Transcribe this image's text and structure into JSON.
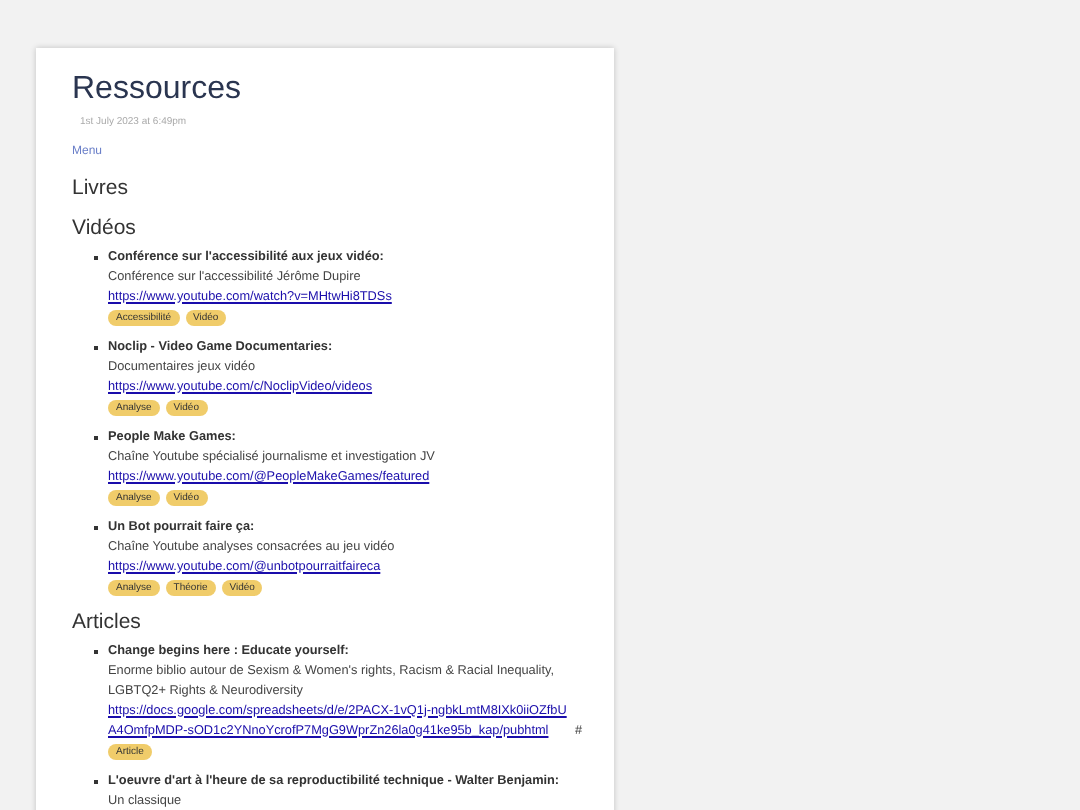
{
  "page": {
    "title": "Ressources",
    "date": "1st July 2023 at 6:49pm",
    "menu_link": "Menu"
  },
  "sections": [
    {
      "title": "Livres"
    },
    {
      "title": "Vidéos",
      "items": [
        {
          "title": "Conférence sur l'accessibilité aux jeux vidéo:",
          "description": "Conférence sur l'accessibilité Jérôme Dupire",
          "link": "https://www.youtube.com/watch?v=MHtwHi8TDSs",
          "tags": [
            "Accessibilité",
            "Vidéo"
          ]
        },
        {
          "title": "Noclip - Video Game Documentaries:",
          "description": "Documentaires jeux vidéo",
          "link": "https://www.youtube.com/c/NoclipVideo/videos",
          "tags": [
            "Analyse",
            "Vidéo"
          ]
        },
        {
          "title": "People Make Games:",
          "description": "Chaîne Youtube spécialisé journalisme et investigation JV",
          "link": "https://www.youtube.com/@PeopleMakeGames/featured",
          "tags": [
            "Analyse",
            "Vidéo"
          ]
        },
        {
          "title": "Un Bot pourrait faire ça:",
          "description": "Chaîne Youtube analyses consacrées au jeu vidéo",
          "link": "https://www.youtube.com/@unbotpourraitfaireca",
          "tags": [
            "Analyse",
            "Théorie",
            "Vidéo"
          ]
        }
      ]
    },
    {
      "title": "Articles",
      "items": [
        {
          "title": "Change begins here : Educate yourself:",
          "description": "Enorme biblio autour de Sexism & Women's rights, Racism & Racial Inequality, LGBTQ2+ Rights & Neurodiversity",
          "link": "https://docs.google.com/spreadsheets/d/e/2PACX-1vQ1j-ngbkLmtM8IXk0iiOZfbUA4OmfpMDP-sOD1c2YNnoYcrofP7MgG9WprZn26la0g41ke95b_kap/pubhtml",
          "suffix": "#",
          "tags": [
            "Article"
          ]
        },
        {
          "title": "L'oeuvre d'art à l'heure de sa reproductibilité technique - Walter Benjamin:",
          "description": "Un classique"
        }
      ]
    }
  ]
}
